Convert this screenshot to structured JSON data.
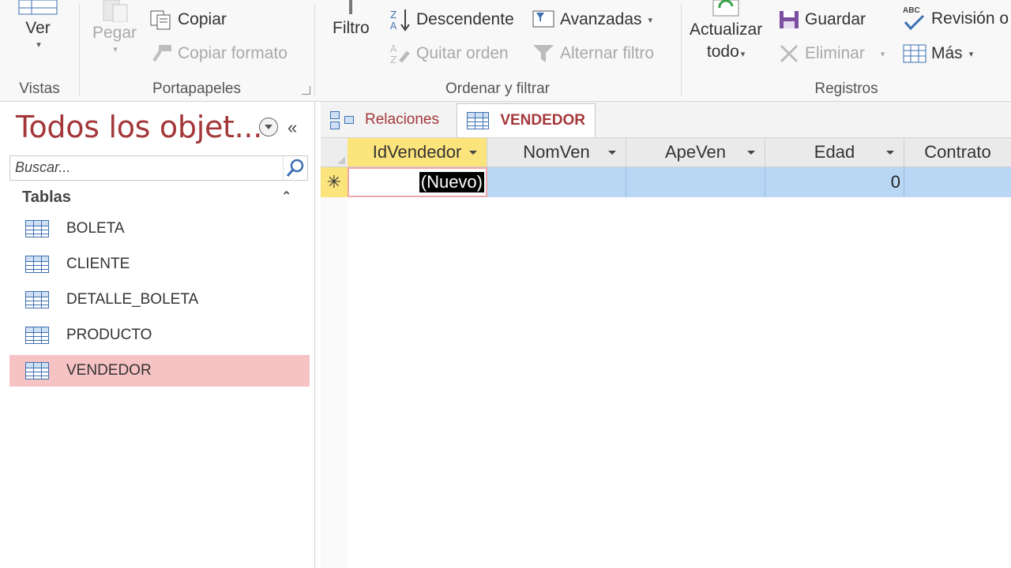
{
  "ribbon": {
    "groups": {
      "vistas": "Vistas",
      "portapapeles": "Portapapeles",
      "ordenar": "Ordenar y filtrar",
      "registros": "Registros"
    },
    "ver": "Ver",
    "pegar": "Pegar",
    "copiar": "Copiar",
    "copiar_formato": "Copiar formato",
    "filtro": "Filtro",
    "descendente": "Descendente",
    "quitar_orden": "Quitar orden",
    "avanzadas": "Avanzadas",
    "alternar_filtro": "Alternar filtro",
    "actualizar_line1": "Actualizar",
    "actualizar_line2": "todo",
    "guardar": "Guardar",
    "eliminar": "Eliminar",
    "revision": "Revisión o",
    "mas": "Más",
    "abc": "ABC"
  },
  "nav": {
    "title": "Todos los objet...",
    "search_placeholder": "Buscar...",
    "section": "Tablas",
    "items": [
      {
        "label": "BOLETA",
        "selected": false
      },
      {
        "label": "CLIENTE",
        "selected": false
      },
      {
        "label": "DETALLE_BOLETA",
        "selected": false
      },
      {
        "label": "PRODUCTO",
        "selected": false
      },
      {
        "label": "VENDEDOR",
        "selected": true
      }
    ]
  },
  "tabs": [
    {
      "label": "Relaciones",
      "active": false
    },
    {
      "label": "VENDEDOR",
      "active": true
    }
  ],
  "grid": {
    "columns": [
      "IdVendedor",
      "NomVen",
      "ApeVen",
      "Edad",
      "Contrato"
    ],
    "new_row_marker": "✳",
    "new_row": {
      "IdVendedor": "(Nuevo)",
      "NomVen": "",
      "ApeVen": "",
      "Edad": "0",
      "Contrato": ""
    }
  },
  "colors": {
    "accent": "#a4373a",
    "selected_nav": "#f6c2c4",
    "active_header": "#fce47d",
    "row_highlight": "#b9d7f5"
  }
}
